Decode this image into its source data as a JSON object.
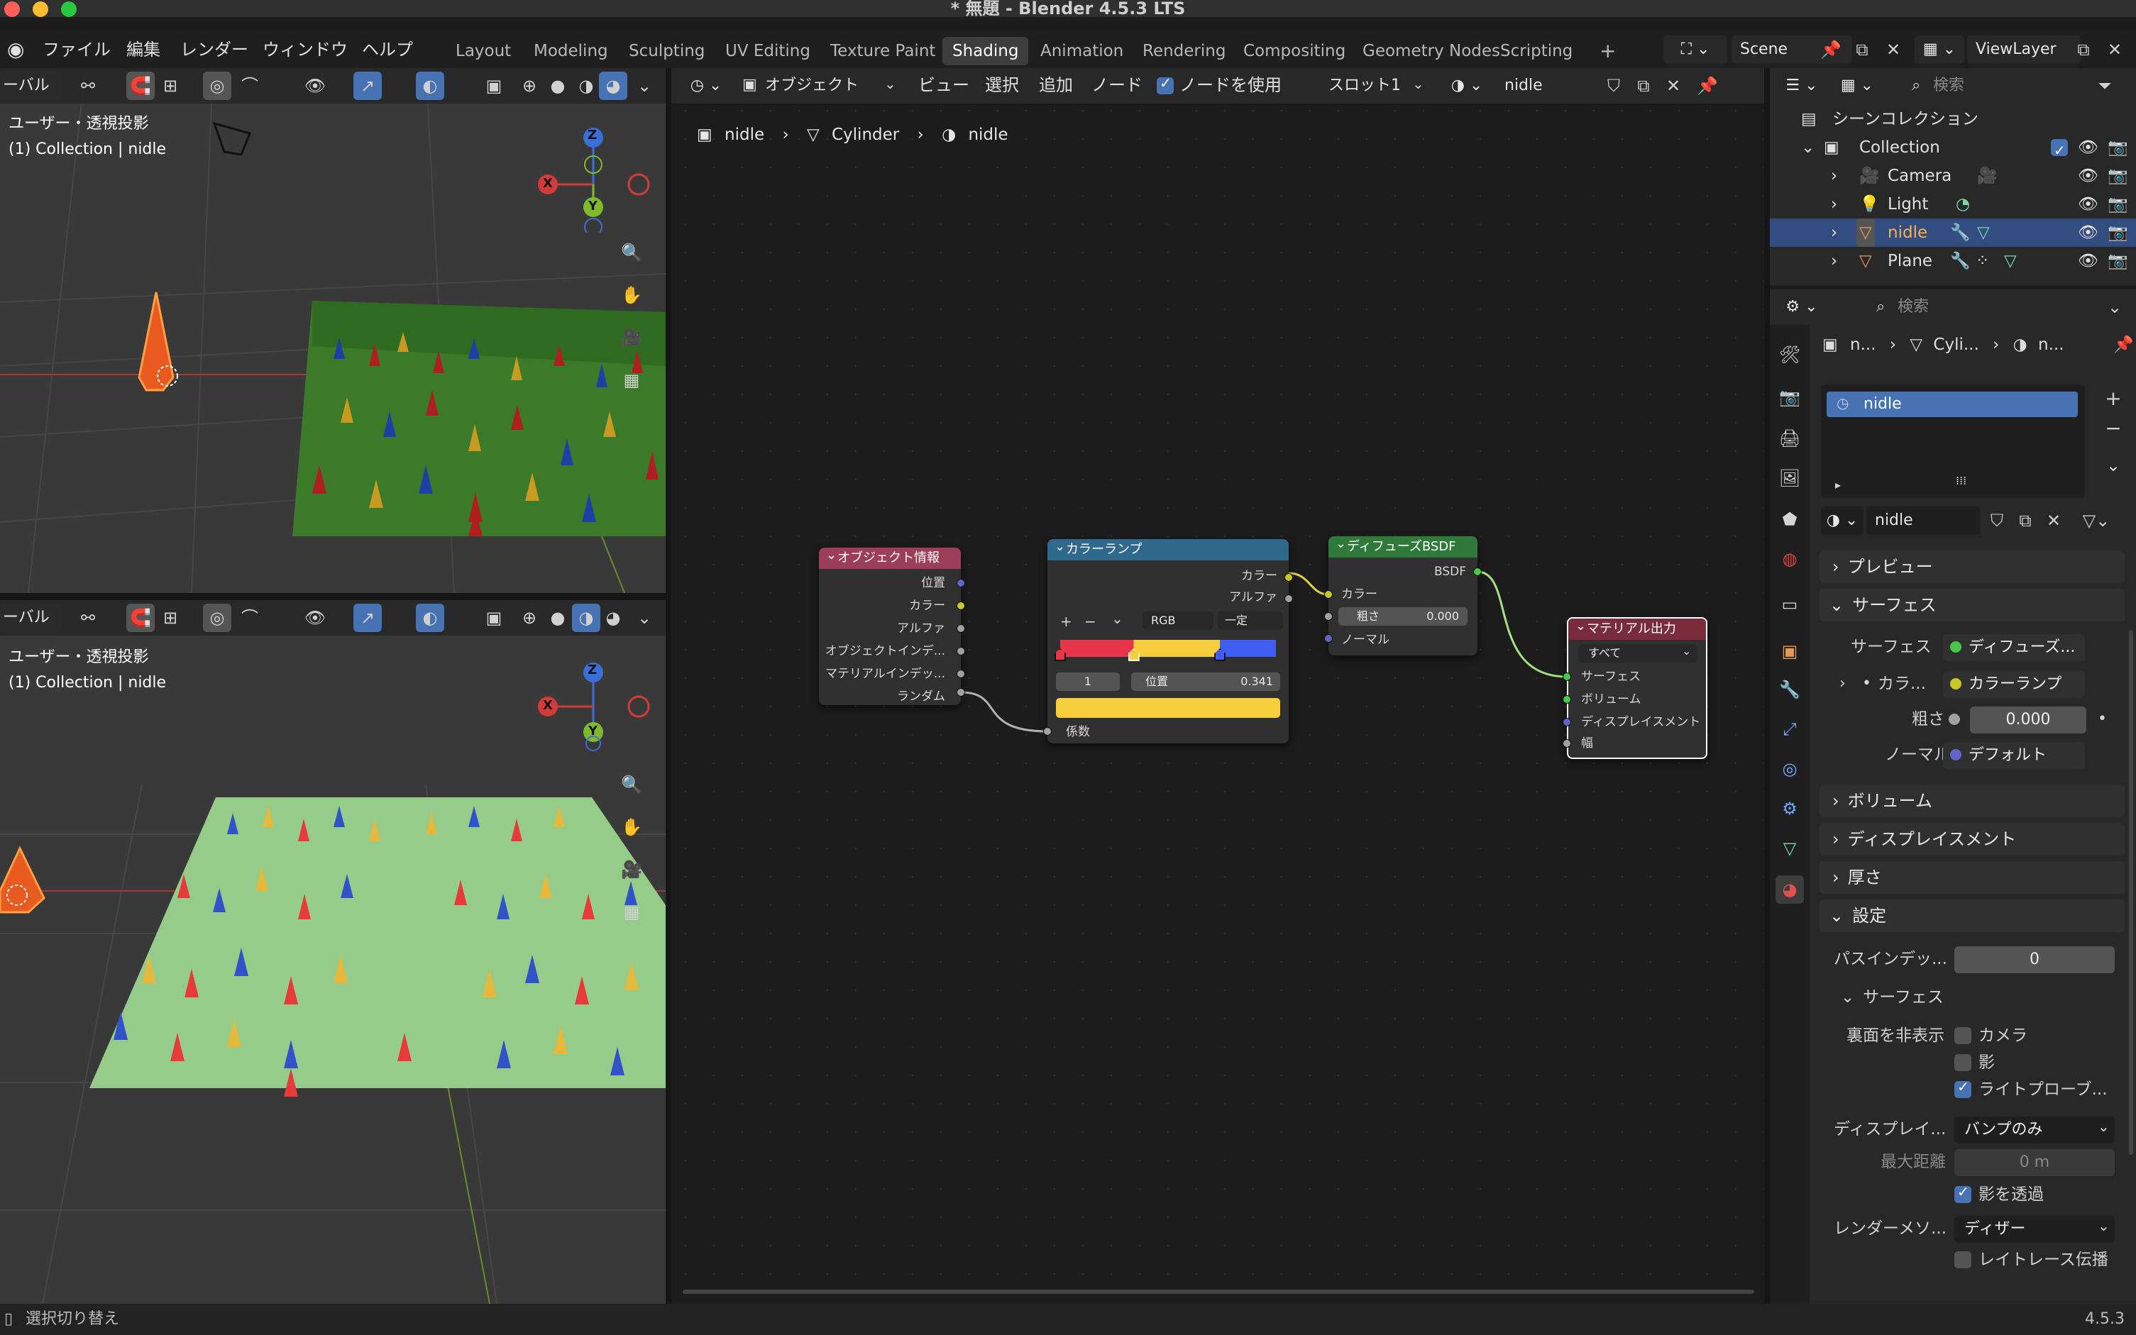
{
  "window": {
    "title": "* 無題 - Blender 4.5.3 LTS",
    "version": "4.5.3"
  },
  "menu": {
    "file": "ファイル",
    "edit": "編集",
    "render": "レンダー",
    "window": "ウィンドウ",
    "help": "ヘルプ"
  },
  "workspaces": [
    "Layout",
    "Modeling",
    "Sculpting",
    "UV Editing",
    "Texture Paint",
    "Shading",
    "Animation",
    "Rendering",
    "Compositing",
    "Geometry Nodes",
    "Scripting"
  ],
  "active_workspace": "Shading",
  "scene": {
    "name": "Scene",
    "view_layer": "ViewLayer"
  },
  "viewport_top": {
    "global_label": "ーバル",
    "line1": "ユーザー・透視投影",
    "line2": "(1) Collection | nidle",
    "axis_x": "X",
    "axis_y": "Y",
    "axis_z": "Z"
  },
  "viewport_bottom": {
    "global_label": "ーバル",
    "line1": "ユーザー・透視投影",
    "line2": "(1) Collection | nidle",
    "axis_x": "X",
    "axis_y": "Y",
    "axis_z": "Z"
  },
  "node_header": {
    "mode": "オブジェクト",
    "view": "ビュー",
    "select": "選択",
    "add": "追加",
    "node": "ノード",
    "use_nodes": "ノードを使用",
    "slot": "スロット1",
    "material": "nidle"
  },
  "breadcrumb": {
    "object": "nidle",
    "mesh": "Cylinder",
    "material": "nidle"
  },
  "nodes": {
    "object_info": {
      "title": "オブジェクト情報",
      "outputs": [
        "位置",
        "カラー",
        "アルファ",
        "オブジェクトインデ...",
        "マテリアルインデッ...",
        "ランダム"
      ]
    },
    "color_ramp": {
      "title": "カラーランプ",
      "out_color": "カラー",
      "out_alpha": "アルファ",
      "mode": "RGB",
      "interp": "一定",
      "index": "1",
      "pos_label": "位置",
      "pos_value": "0.341",
      "in_fac": "係数",
      "btn_add": "+",
      "btn_remove": "−",
      "stops": [
        0.0,
        0.341,
        0.741
      ]
    },
    "diffuse": {
      "title": "ディフューズBSDF",
      "out": "BSDF",
      "in_color": "カラー",
      "rough_label": "粗さ",
      "rough_value": "0.000",
      "in_normal": "ノーマル"
    },
    "output": {
      "title": "マテリアル出力",
      "target": "すべて",
      "in_surface": "サーフェス",
      "in_volume": "ボリューム",
      "in_disp": "ディスプレイスメント",
      "in_width": "幅"
    }
  },
  "outliner": {
    "search_placeholder": "検索",
    "scene_collection": "シーンコレクション",
    "items": [
      {
        "label": "Collection"
      },
      {
        "label": "Camera"
      },
      {
        "label": "Light"
      },
      {
        "label": "nidle"
      },
      {
        "label": "Plane"
      }
    ]
  },
  "properties": {
    "search_placeholder": "検索",
    "breadcrumb": [
      "n...",
      "Cyli...",
      "n..."
    ],
    "slot_item": "nidle",
    "material_name": "nidle",
    "panels": {
      "preview": "プレビュー",
      "surface": "サーフェス",
      "volume": "ボリューム",
      "displacement": "ディスプレイスメント",
      "thickness": "厚さ",
      "settings": "設定",
      "surface_sub": "サーフェス"
    },
    "surface_label": "サーフェス",
    "surface_value": "ディフューズ...",
    "color_label": "カラ...",
    "color_value": "カラーランプ",
    "rough_label": "粗さ",
    "rough_value": "0.000",
    "normal_label": "ノーマル",
    "normal_value": "デフォルト",
    "pass_label": "パスインデッ...",
    "pass_value": "0",
    "backface_label": "裏面を非表示",
    "camera": "カメラ",
    "shadow": "影",
    "lightprobe": "ライトプローブ...",
    "disp_label": "ディスプレイ...",
    "disp_value": "バンプのみ",
    "maxdist_label": "最大距離",
    "maxdist_value": "0 m",
    "transparent_shadow": "影を透過",
    "render_method_label": "レンダーメソ...",
    "render_method_value": "ディザー",
    "raytrace": "レイトレース伝播"
  },
  "status": {
    "left": "選択切り替え",
    "right": "4.5.3"
  },
  "colors": {
    "accent": "#4772b3",
    "ramp_red": "#e8354a",
    "ramp_yellow": "#f6cd3c",
    "ramp_blue": "#3d5ef0"
  }
}
